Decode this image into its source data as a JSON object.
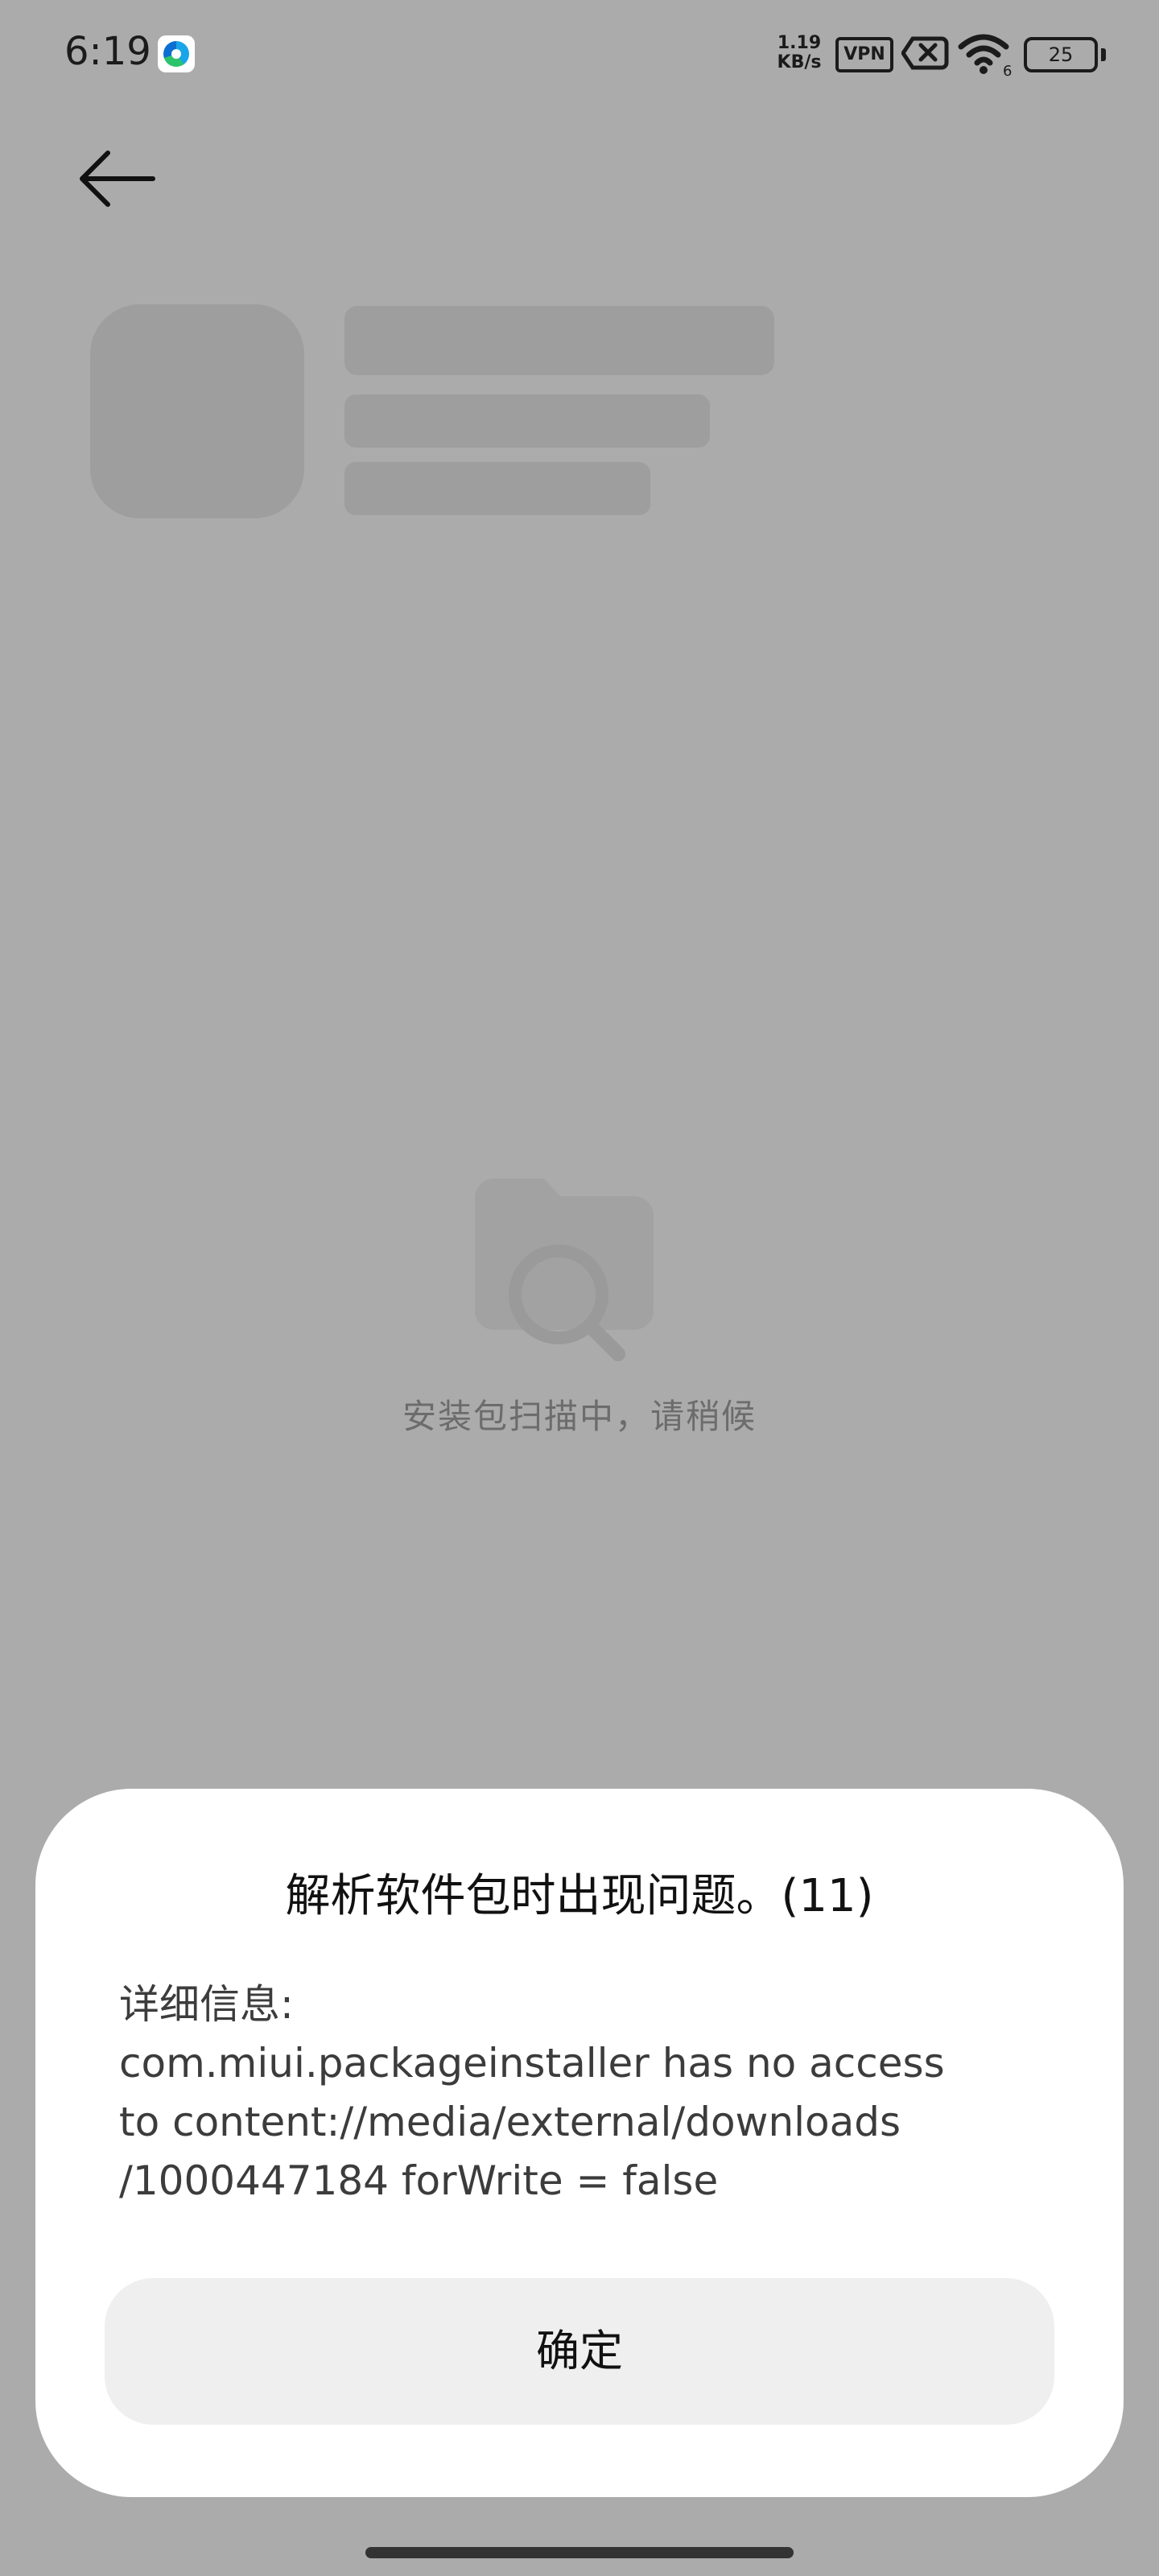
{
  "status_bar": {
    "time": "6:19",
    "net_speed_value": "1.19",
    "net_speed_unit": "KB/s",
    "vpn_label": "VPN",
    "wifi_label": "6",
    "battery": "25"
  },
  "scan": {
    "message": "安装包扫描中，请稍候"
  },
  "dialog": {
    "title": "解析软件包时出现问题。(11)",
    "detail_lines": [
      "详细信息:",
      "com.miui.packageinstaller has no access",
      "to content://media/external/downloads",
      "/1000447184 forWrite = false"
    ],
    "confirm_label": "确定"
  },
  "colors": {
    "overlay_background": "#ababab",
    "dialog_background": "#ffffff",
    "button_background": "#efefef"
  },
  "icons": [
    "edge-browser-icon",
    "vpn-icon",
    "sim-off-icon",
    "wifi-icon",
    "battery-icon",
    "back-arrow-icon",
    "folder-search-icon"
  ]
}
